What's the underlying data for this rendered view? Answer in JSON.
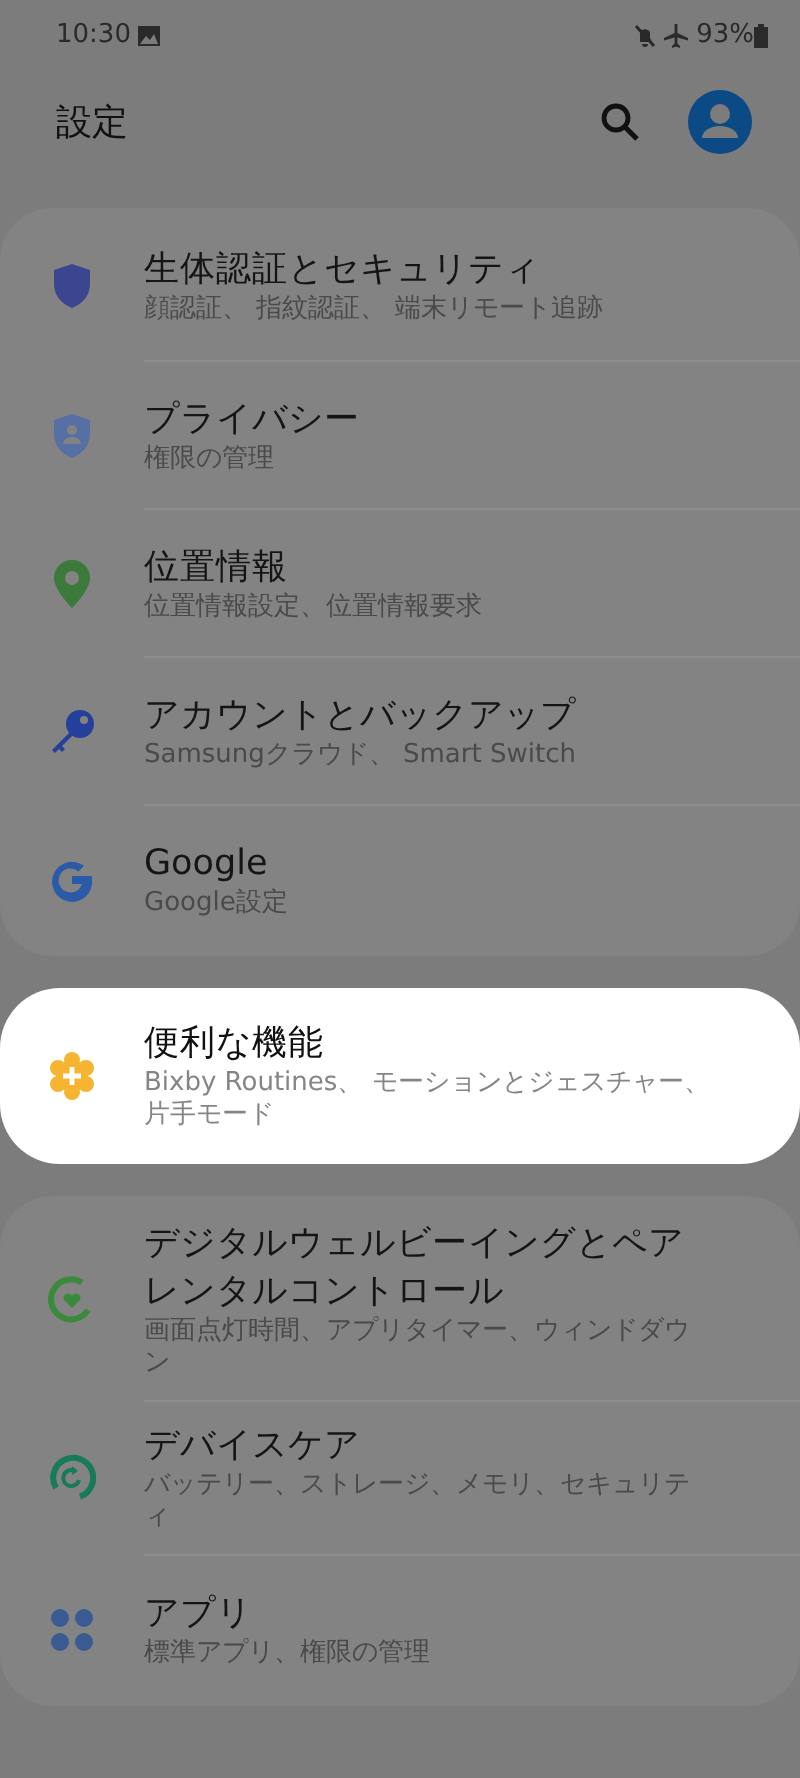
{
  "status_bar": {
    "time": "10:30",
    "battery": "93%"
  },
  "header": {
    "title": "設定"
  },
  "groups": [
    {
      "highlighted": false,
      "items": [
        {
          "title": "生体認証とセキュリティ",
          "subtitle": "顔認証、 指紋認証、 端末リモート追跡"
        },
        {
          "title": "プライバシー",
          "subtitle": "権限の管理"
        },
        {
          "title": "位置情報",
          "subtitle": "位置情報設定、位置情報要求"
        },
        {
          "title": "アカウントとバックアップ",
          "subtitle": "Samsungクラウド、 Smart Switch"
        },
        {
          "title": "Google",
          "subtitle": "Google設定"
        }
      ]
    },
    {
      "highlighted": true,
      "items": [
        {
          "title": "便利な機能",
          "subtitle": "Bixby Routines、 モーションとジェスチャー、片手モード"
        }
      ]
    },
    {
      "highlighted": false,
      "items": [
        {
          "title": "デジタルウェルビーイングとペアレンタルコントロール",
          "subtitle": "画面点灯時間、アプリタイマー、ウィンドダウン"
        },
        {
          "title": "デバイスケア",
          "subtitle": "バッテリー、ストレージ、メモリ、セキュリティ"
        },
        {
          "title": "アプリ",
          "subtitle": "標準アプリ、権限の管理"
        }
      ]
    }
  ]
}
